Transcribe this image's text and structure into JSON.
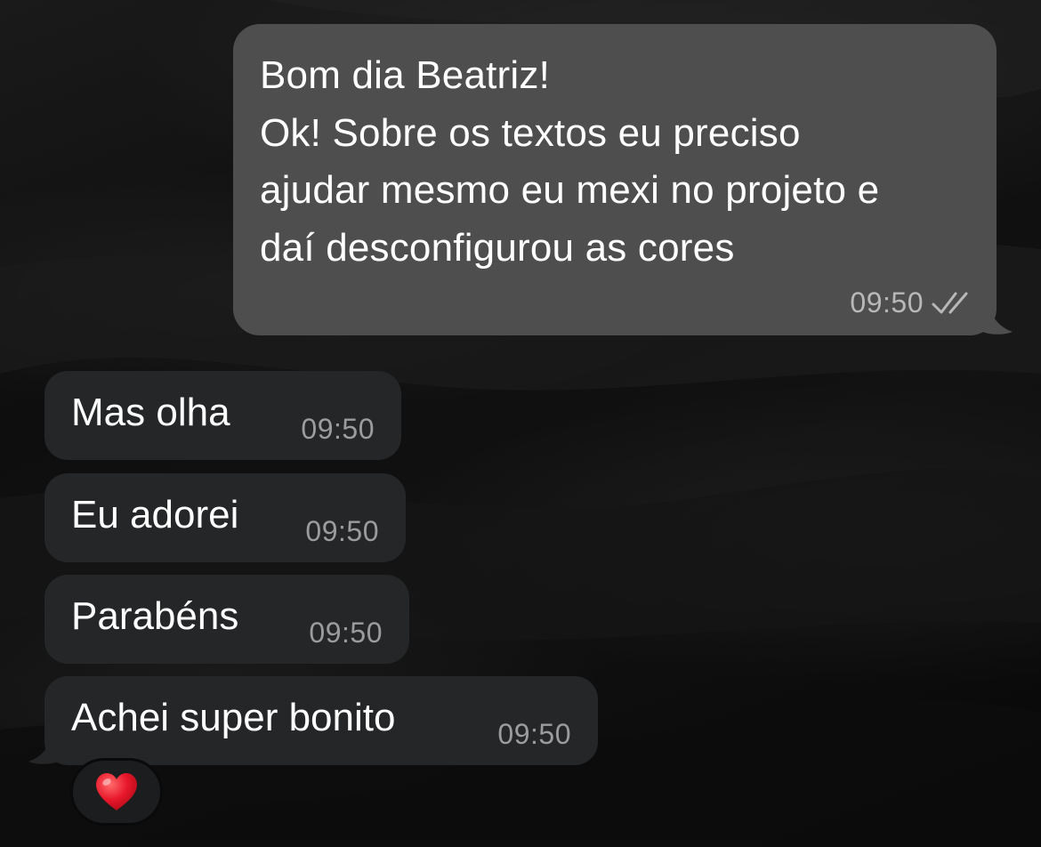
{
  "chat": {
    "outgoing": {
      "lines": [
        "Bom dia Beatriz!",
        "Ok! Sobre os textos eu preciso",
        "ajudar mesmo eu mexi no projeto e",
        "daí desconfigurou as cores"
      ],
      "time": "09:50",
      "status_icon": "double-check-icon"
    },
    "incoming": [
      {
        "text": "Mas olha",
        "time": "09:50"
      },
      {
        "text": "Eu adorei",
        "time": "09:50"
      },
      {
        "text": "Parabéns",
        "time": "09:50"
      },
      {
        "text": "Achei super bonito",
        "time": "09:50"
      }
    ],
    "reaction": {
      "icon": "red-heart-icon"
    }
  },
  "colors": {
    "outgoing_bubble": "#4e4e4e",
    "incoming_bubble": "#242627",
    "reaction_heart": "#e8182b"
  }
}
